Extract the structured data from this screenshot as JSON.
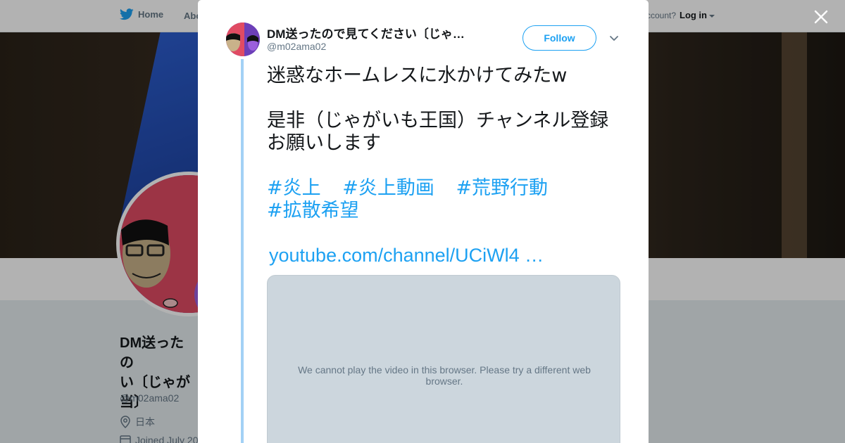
{
  "background": {
    "nav": {
      "home_label": "Home",
      "about_label": "Abo",
      "account_text": "ccount?",
      "login_label": "Log in"
    },
    "profile": {
      "name_lines": [
        "DM送ったの",
        "い〔じゃが",
        "当〕"
      ],
      "handle": "@m02ama02",
      "location": "日本",
      "joined": "Joined July 20"
    }
  },
  "modal": {
    "author": {
      "name": "DM送ったので見てください〔じゃ…",
      "handle": "@m02ama02"
    },
    "follow_label": "Follow",
    "tweet": {
      "line1": "迷惑なホームレスに水かけてみたw",
      "line2": "是非（じゃがいも王国）チャンネル登録お願いします",
      "hashtags_row1": [
        "#炎上",
        "#炎上動画",
        "#荒野行動"
      ],
      "hashtags_row2": [
        "#拡散希望"
      ],
      "link_text": "youtube.com/channel/UCiWl4 …"
    },
    "video": {
      "message": "We cannot play the video in this browser. Please try a different web browser."
    }
  },
  "colors": {
    "accent": "#1da1f2",
    "thread_line": "#a3d1f5",
    "video_placeholder": "#ccd6dd"
  },
  "icons": {
    "nav_logo": "bird-icon",
    "close": "close-icon",
    "more": "chevron-down-icon",
    "location": "location-pin-icon",
    "calendar": "calendar-icon"
  }
}
